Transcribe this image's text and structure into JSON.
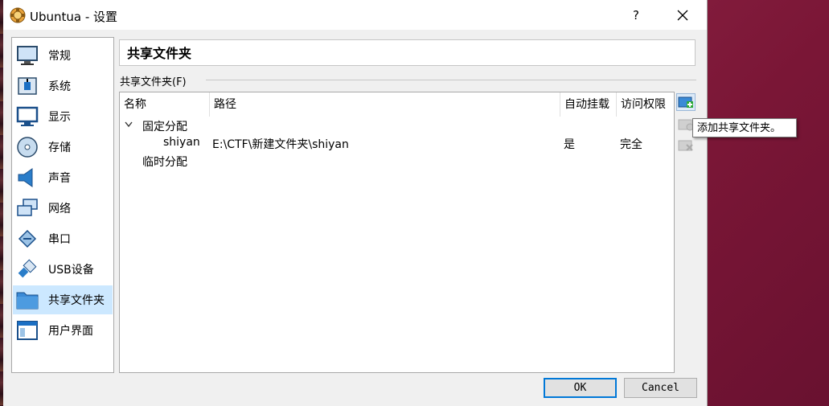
{
  "window": {
    "title": "Ubuntua - 设置",
    "help_label": "?"
  },
  "sidebar": {
    "items": [
      {
        "label": "常规",
        "icon": "general-monitor-icon"
      },
      {
        "label": "系统",
        "icon": "system-chip-icon"
      },
      {
        "label": "显示",
        "icon": "display-monitor-icon"
      },
      {
        "label": "存储",
        "icon": "storage-disc-icon"
      },
      {
        "label": "声音",
        "icon": "speaker-icon"
      },
      {
        "label": "网络",
        "icon": "network-icon"
      },
      {
        "label": "串口",
        "icon": "serial-port-icon"
      },
      {
        "label": "USB设备",
        "icon": "usb-icon"
      },
      {
        "label": "共享文件夹",
        "icon": "shared-folder-icon",
        "selected": true
      },
      {
        "label": "用户界面",
        "icon": "user-interface-icon"
      }
    ]
  },
  "page": {
    "title": "共享文件夹",
    "group_label": "共享文件夹(F)"
  },
  "table": {
    "columns": [
      "名称",
      "路径",
      "自动挂载",
      "访问权限"
    ],
    "groups": [
      {
        "name": "固定分配",
        "expanded": true,
        "rows": [
          {
            "name": "shiyan",
            "path": "E:\\CTF\\新建文件夹\\shiyan",
            "auto_mount": "是",
            "access": "完全"
          }
        ]
      },
      {
        "name": "临时分配",
        "expanded": false,
        "rows": []
      }
    ]
  },
  "tooltip": "添加共享文件夹。",
  "buttons": {
    "ok": "OK",
    "cancel": "Cancel"
  },
  "colors": {
    "selection": "#cce8ff",
    "accent": "#0078d7",
    "desktop": "#8e2445"
  }
}
